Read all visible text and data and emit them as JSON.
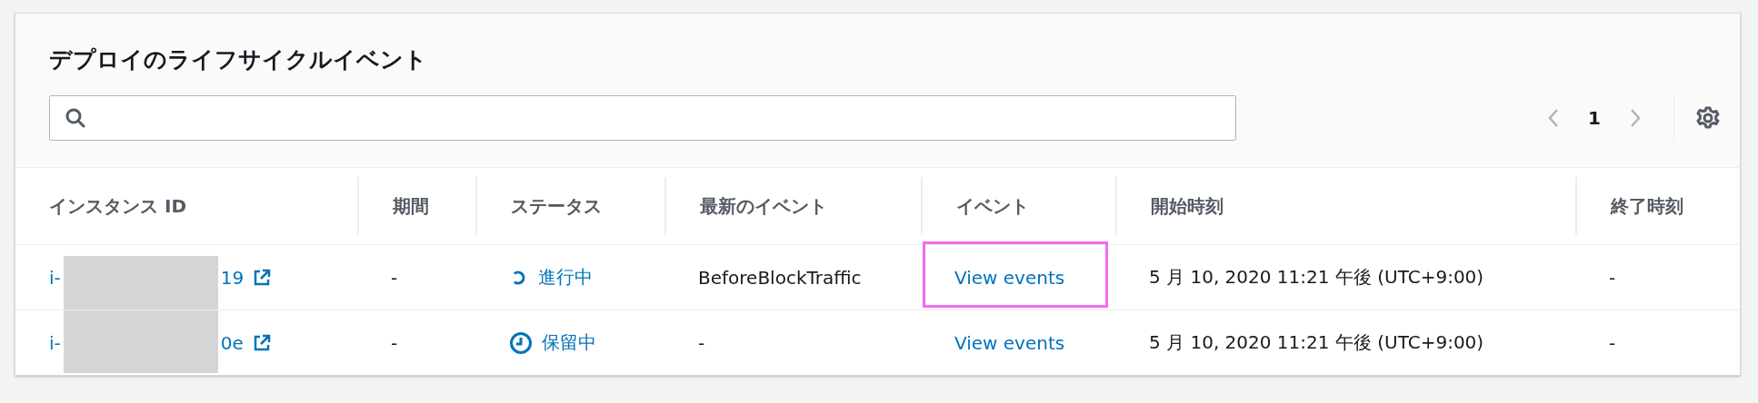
{
  "title": "デプロイのライフサイクルイベント",
  "pagination": {
    "page": "1",
    "prev_disabled": true,
    "next_disabled": true
  },
  "table": {
    "columns": [
      "インスタンス ID",
      "期間",
      "ステータス",
      "最新のイベント",
      "イベント",
      "開始時刻",
      "終了時刻"
    ],
    "rows": [
      {
        "instance_prefix": "i-",
        "instance_suffix": "19",
        "redacted": true,
        "duration": "-",
        "status": {
          "kind": "in_progress",
          "label": "進行中"
        },
        "latest_event": "BeforeBlockTraffic",
        "events_link": "View events",
        "highlighted": true,
        "start": "5 月 10, 2020 11:21 午後 (UTC+9:00)",
        "end": "-"
      },
      {
        "instance_prefix": "i-",
        "instance_suffix": "0e",
        "redacted": true,
        "duration": "-",
        "status": {
          "kind": "pending",
          "label": "保留中"
        },
        "latest_event": "-",
        "events_link": "View events",
        "highlighted": false,
        "start": "5 月 10, 2020 11:21 午後 (UTC+9:00)",
        "end": "-"
      }
    ]
  }
}
